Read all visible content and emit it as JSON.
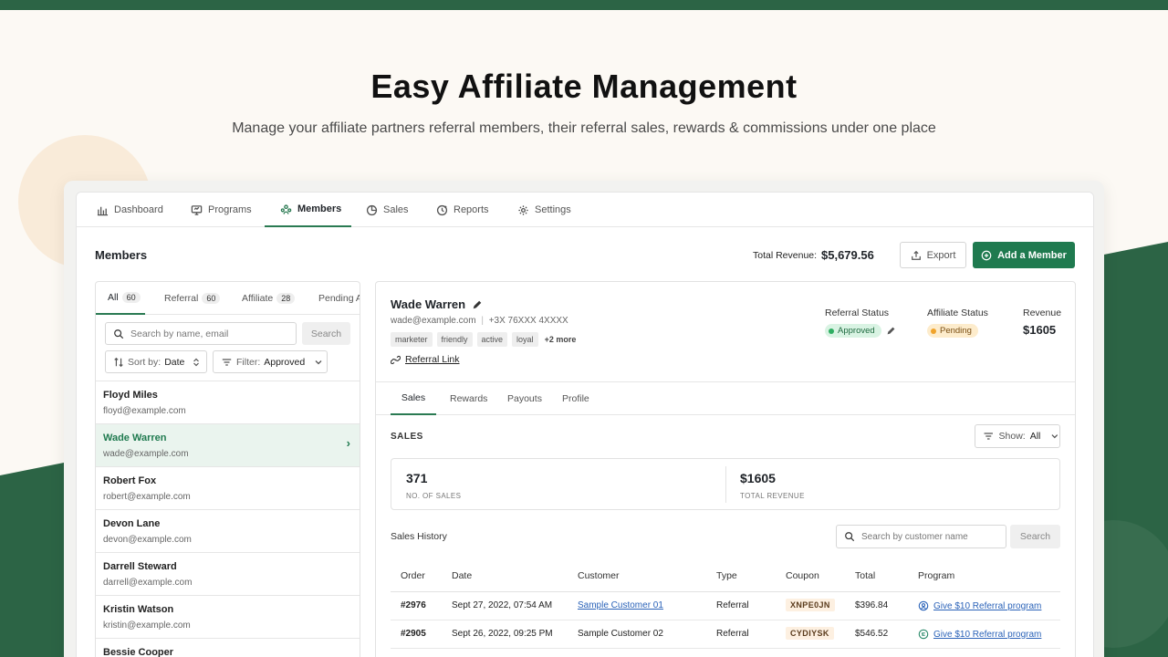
{
  "hero": {
    "title": "Easy Affiliate Management",
    "subtitle": "Manage your affiliate partners referral members, their referral sales, rewards & commissions under one place"
  },
  "nav": {
    "items": [
      {
        "label": "Dashboard",
        "icon": "bar-chart-icon"
      },
      {
        "label": "Programs",
        "icon": "monitor-icon"
      },
      {
        "label": "Members",
        "icon": "members-icon",
        "active": true
      },
      {
        "label": "Sales",
        "icon": "pie-chart-icon"
      },
      {
        "label": "Reports",
        "icon": "reports-icon"
      },
      {
        "label": "Settings",
        "icon": "gear-icon"
      }
    ]
  },
  "header": {
    "title": "Members",
    "revenue_label": "Total Revenue:",
    "revenue_value": "$5,679.56",
    "export_label": "Export",
    "add_label": "Add a Member"
  },
  "left": {
    "tabs": [
      {
        "label": "All",
        "count": "60"
      },
      {
        "label": "Referral",
        "count": "60"
      },
      {
        "label": "Affiliate",
        "count": "28"
      },
      {
        "label": "Pending A",
        "count": ""
      }
    ],
    "search_placeholder": "Search by name, email",
    "search_button": "Search",
    "sort_prefix": "Sort by:",
    "sort_value": "Date",
    "filter_prefix": "Filter:",
    "filter_value": "Approved",
    "members": [
      {
        "name": "Floyd Miles",
        "email": "floyd@example.com"
      },
      {
        "name": "Wade Warren",
        "email": "wade@example.com",
        "selected": true
      },
      {
        "name": "Robert Fox",
        "email": "robert@example.com"
      },
      {
        "name": "Devon Lane",
        "email": "devon@example.com"
      },
      {
        "name": "Darrell Steward",
        "email": "darrell@example.com"
      },
      {
        "name": "Kristin Watson",
        "email": "kristin@example.com"
      },
      {
        "name": "Bessie Cooper",
        "email": ""
      }
    ]
  },
  "profile": {
    "name": "Wade Warren",
    "email": "wade@example.com",
    "phone": "+3X 76XXX 4XXXX",
    "tags": [
      "marketer",
      "friendly",
      "active",
      "loyal"
    ],
    "more_tags": "+2 more",
    "referral_link": "Referral Link",
    "referral_status_label": "Referral Status",
    "referral_status": "Approved",
    "affiliate_status_label": "Affiliate Status",
    "affiliate_status": "Pending",
    "revenue_label": "Revenue",
    "revenue_value": "$1605",
    "colors": {
      "approved_bg": "#d9f3e3",
      "approved_dot": "#2fae62",
      "pending_bg": "#fdeccc",
      "pending_dot": "#f0a32b"
    }
  },
  "detail_tabs": [
    "Sales",
    "Rewards",
    "Payouts",
    "Profile"
  ],
  "sales": {
    "heading": "SALES",
    "show_prefix": "Show:",
    "show_value": "All",
    "stats": [
      {
        "value": "371",
        "label": "NO. OF SALES"
      },
      {
        "value": "$1605",
        "label": "TOTAL REVENUE"
      }
    ],
    "history_title": "Sales History",
    "search_placeholder": "Search by customer name",
    "search_button": "Search",
    "columns": [
      "Order",
      "Date",
      "Customer",
      "Type",
      "Coupon",
      "Total",
      "Program"
    ],
    "rows": [
      {
        "order": "#2976",
        "date": "Sept 27, 2022, 07:54 AM",
        "customer": "Sample Customer 01",
        "customer_link": true,
        "type": "Referral",
        "coupon": "XNPE0JN",
        "total": "$396.84",
        "program": "Give $10 Referral program"
      },
      {
        "order": "#2905",
        "date": "Sept 26, 2022, 09:25 PM",
        "customer": "Sample Customer 02",
        "customer_link": false,
        "type": "Referral",
        "coupon": "CYDIYSK",
        "total": "$546.52",
        "program": "Give $10 Referral program"
      }
    ]
  }
}
